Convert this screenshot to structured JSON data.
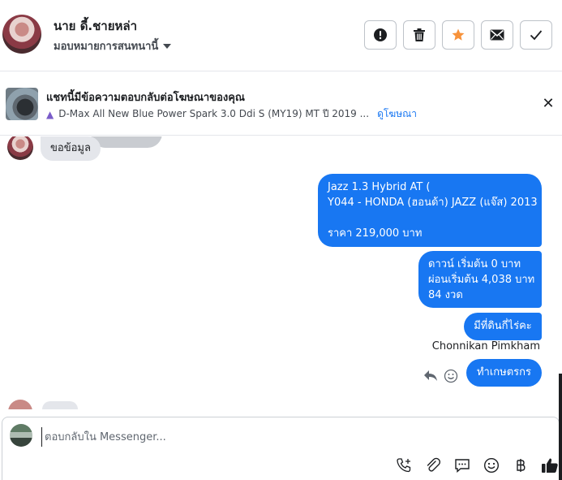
{
  "header": {
    "contact_name": "นาย ดี้.ชายหล่า",
    "assign_label": "มอบหมายการสนทนานี้",
    "actions": [
      {
        "name": "mark-spam-button",
        "icon": "exclamation-icon"
      },
      {
        "name": "delete-button",
        "icon": "trash-icon"
      },
      {
        "name": "star-button",
        "icon": "star-icon",
        "color": "#f7923a"
      },
      {
        "name": "mark-unread-button",
        "icon": "envelope-icon"
      },
      {
        "name": "mark-done-button",
        "icon": "check-icon"
      }
    ]
  },
  "ad_banner": {
    "title": "แชทนี้มีข้อความตอบกลับต่อโฆษณาของคุณ",
    "ad_name": "D-Max All New Blue Power Spark 3.0 Ddi S (MY19) MT ปี 2019 ...",
    "view_ad_link": "ดูโฆษณา"
  },
  "messages": {
    "incoming_1": "ขอข้อมูล",
    "outgoing_1": "Jazz 1.3 Hybrid AT (\nY044 - HONDA (ฮอนด้า) JAZZ (แจ๊ส) 2013\n\nราคา 219,000 บาท",
    "outgoing_2": "ดาวน์ เริ่มต้น 0 บาท\nผ่อนเริ่มต้น 4,038 บาท\n84 งวด",
    "outgoing_3": "มีที่ดินกี่ไร่คะ",
    "sender_name": "Chonnikan Pimkham",
    "outgoing_4": "ทำเกษตรกร"
  },
  "composer": {
    "placeholder": "ตอบกลับใน Messenger..."
  },
  "colors": {
    "accent": "#1877f2",
    "bubble_in": "#e4e6eb",
    "star": "#f7923a"
  }
}
